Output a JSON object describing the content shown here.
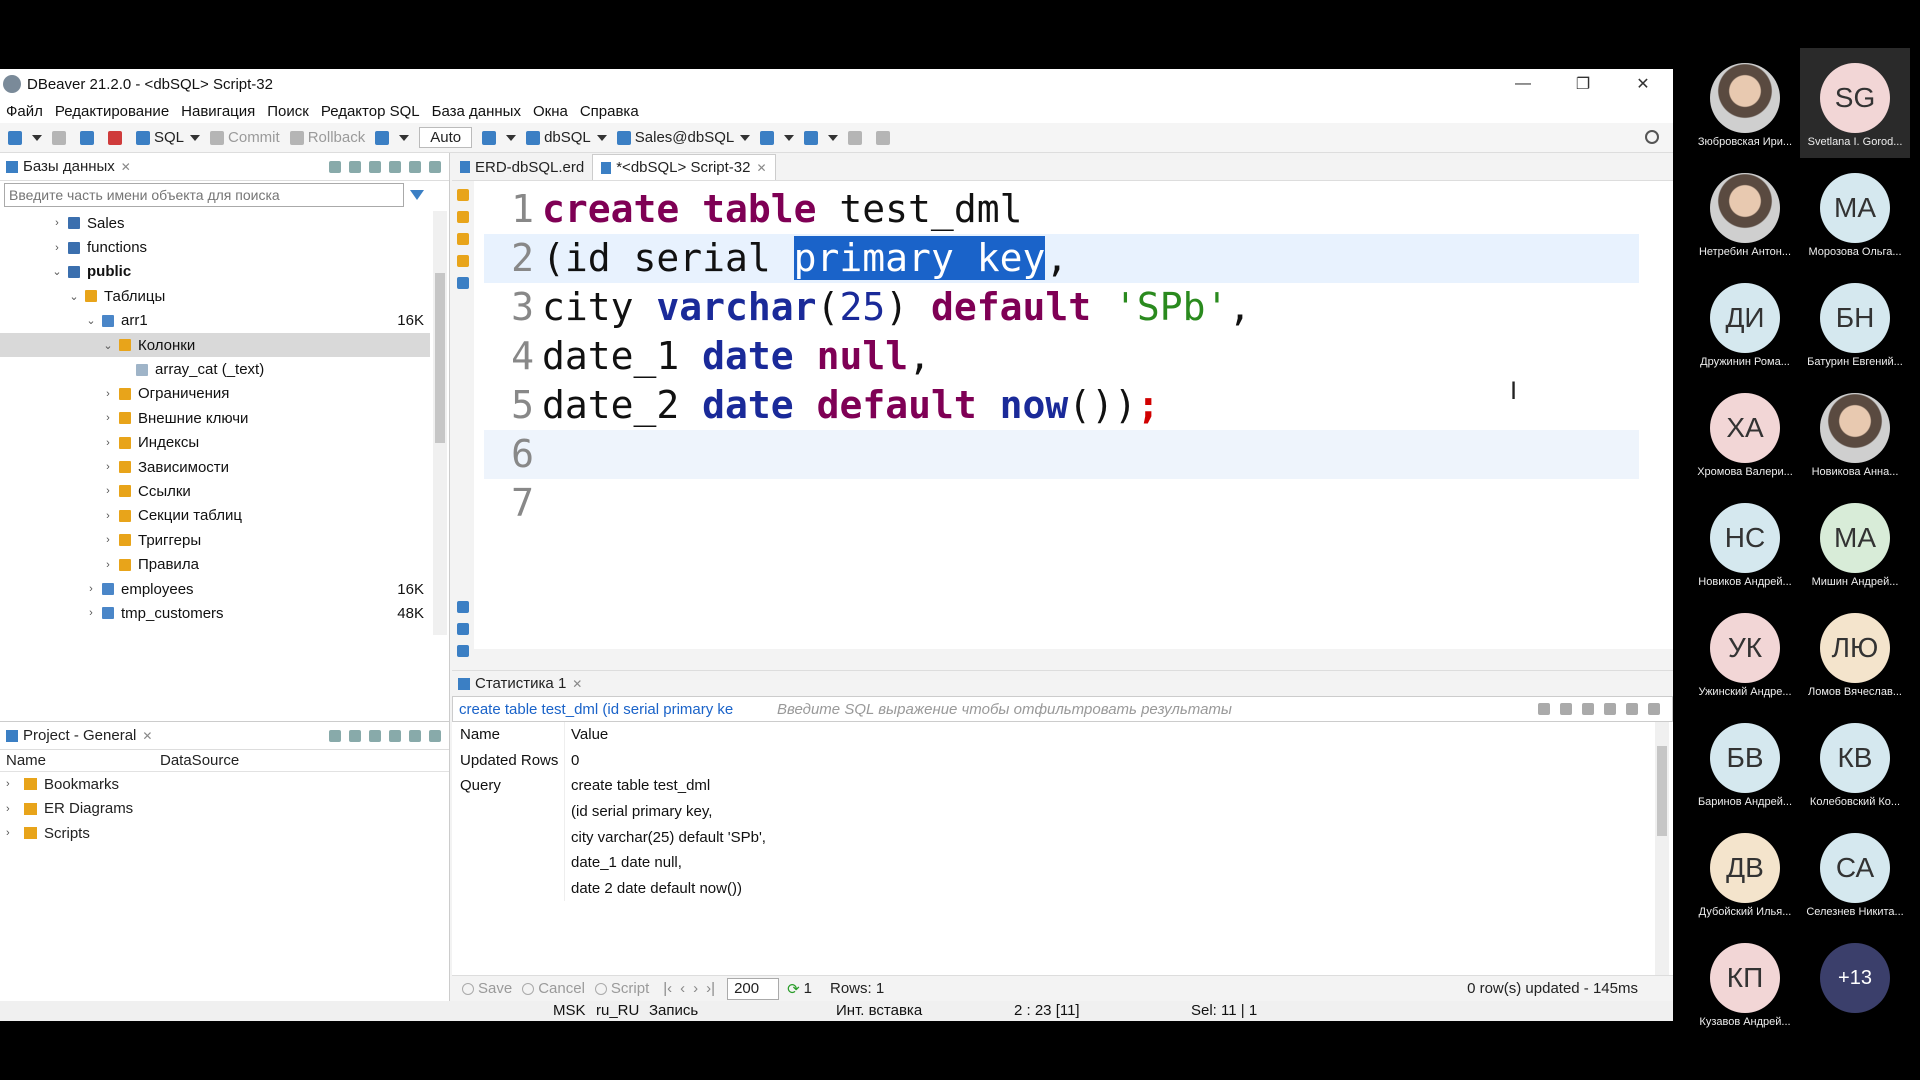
{
  "window": {
    "title": "DBeaver 21.2.0 - <dbSQL> Script-32",
    "minimize": "—",
    "restore": "❐",
    "close": "✕"
  },
  "menu": [
    "Файл",
    "Редактирование",
    "Навигация",
    "Поиск",
    "Редактор SQL",
    "База данных",
    "Окна",
    "Справка"
  ],
  "toolbar": {
    "sql": "SQL",
    "commit": "Commit",
    "rollback": "Rollback",
    "mode": "Auto",
    "datasource": "dbSQL",
    "schema": "Sales@dbSQL"
  },
  "db_panel": {
    "tab": "Базы данных",
    "filter_placeholder": "Введите часть имени объекта для поиска",
    "tree": [
      {
        "label": "Sales",
        "level": 1,
        "arrow": "›",
        "icon": "schema"
      },
      {
        "label": "functions",
        "level": 1,
        "arrow": "›",
        "icon": "schema"
      },
      {
        "label": "public",
        "level": 1,
        "arrow": "⌄",
        "icon": "schema",
        "bold": true
      },
      {
        "label": "Таблицы",
        "level": 2,
        "arrow": "⌄",
        "icon": "folder-table"
      },
      {
        "label": "arr1",
        "level": 3,
        "arrow": "⌄",
        "icon": "table",
        "size": "16K"
      },
      {
        "label": "Колонки",
        "level": 4,
        "arrow": "⌄",
        "icon": "folder",
        "selected": true
      },
      {
        "label": "array_cat (_text)",
        "level": 5,
        "arrow": "",
        "icon": "grid"
      },
      {
        "label": "Ограничения",
        "level": 4,
        "arrow": "›",
        "icon": "folder"
      },
      {
        "label": "Внешние ключи",
        "level": 4,
        "arrow": "›",
        "icon": "folder"
      },
      {
        "label": "Индексы",
        "level": 4,
        "arrow": "›",
        "icon": "folder"
      },
      {
        "label": "Зависимости",
        "level": 4,
        "arrow": "›",
        "icon": "folder"
      },
      {
        "label": "Ссылки",
        "level": 4,
        "arrow": "›",
        "icon": "folder"
      },
      {
        "label": "Секции таблиц",
        "level": 4,
        "arrow": "›",
        "icon": "folder-table"
      },
      {
        "label": "Триггеры",
        "level": 4,
        "arrow": "›",
        "icon": "folder"
      },
      {
        "label": "Правила",
        "level": 4,
        "arrow": "›",
        "icon": "folder"
      },
      {
        "label": "employees",
        "level": 3,
        "arrow": "›",
        "icon": "table",
        "size": "16K"
      },
      {
        "label": "tmp_customers",
        "level": 3,
        "arrow": "›",
        "icon": "table",
        "size": "48K"
      }
    ]
  },
  "project_panel": {
    "tab": "Project - General",
    "col_name": "Name",
    "col_datasource": "DataSource",
    "items": [
      "Bookmarks",
      "ER Diagrams",
      "Scripts"
    ]
  },
  "editor": {
    "tabs": [
      {
        "label": "ERD-dbSQL.erd",
        "active": false
      },
      {
        "label": "*<dbSQL> Script-32",
        "active": true
      }
    ],
    "line_numbers": [
      "1",
      "2",
      "3",
      "4",
      "5",
      "6",
      "7"
    ],
    "code": {
      "l1_kw": "create table",
      "l1_rest": " test_dml",
      "l2_pre": "(id serial ",
      "l2_sel": "primary key",
      "l2_post": ",",
      "l3_a": "city ",
      "l3_type": "varchar",
      "l3_p1": "(",
      "l3_num": "25",
      "l3_p2": ") ",
      "l3_kw": "default",
      "l3_sp": " ",
      "l3_str": "'SPb'",
      "l3_end": ",",
      "l4_a": "date_1 ",
      "l4_type": "date",
      "l4_sp": " ",
      "l4_kw": "null",
      "l4_end": ",",
      "l5_a": "date_2 ",
      "l5_type": "date",
      "l5_sp": " ",
      "l5_kw": "default",
      "l5_sp2": " ",
      "l5_fn": "now",
      "l5_end": "())",
      "l5_semi": ";"
    },
    "text_cursor": "I"
  },
  "results": {
    "tab": "Статистика 1",
    "query_preview": "create table test_dml (id serial primary ke",
    "filter_placeholder": "Введите SQL выражение чтобы отфильтровать результаты",
    "header": {
      "name": "Name",
      "value": "Value"
    },
    "rows": [
      {
        "name": "Updated Rows",
        "value": "0"
      },
      {
        "name": "Query",
        "value": "create table test_dml"
      },
      {
        "name": "",
        "value": "(id serial primary key,"
      },
      {
        "name": "",
        "value": "city varchar(25) default 'SPb',"
      },
      {
        "name": "",
        "value": "date_1 date null,"
      },
      {
        "name": "",
        "value": "date 2 date default now())"
      }
    ],
    "footer": {
      "save": "Save",
      "cancel": "Cancel",
      "script": "Script",
      "fetch_size": "200",
      "refresh_count": "1",
      "rows": "Rows: 1",
      "updated": "0 row(s) updated - 145ms"
    }
  },
  "statusbar": {
    "tz": "MSK",
    "locale": "ru_RU",
    "mode": "Запись",
    "insert": "Инт. вставка",
    "position": "2 : 23 [11]",
    "selection": "Sel: 11 | 1"
  },
  "participants": [
    {
      "initials": "",
      "name": "Зюбровская Ири...",
      "photo": true,
      "color": "#d9d9d9"
    },
    {
      "initials": "SG",
      "name": "Svetlana I. Gorod...",
      "color": "#f2d6d6",
      "active": true
    },
    {
      "initials": "",
      "name": "Нетребин Антон...",
      "photo": true,
      "color": "#c98a6a"
    },
    {
      "initials": "МА",
      "name": "Морозова Ольга...",
      "color": "#d5e8ef"
    },
    {
      "initials": "ДИ",
      "name": "Дружинин Рома...",
      "color": "#d5e8ef"
    },
    {
      "initials": "БН",
      "name": "Батурин Евгений...",
      "color": "#d5e8ef"
    },
    {
      "initials": "ХА",
      "name": "Хромова Валери...",
      "color": "#f2d6d6"
    },
    {
      "initials": "",
      "name": "Новикова Анна...",
      "photo": true,
      "color": "#bbbbbb"
    },
    {
      "initials": "НС",
      "name": "Новиков Андрей...",
      "color": "#d5e8ef"
    },
    {
      "initials": "МА",
      "name": "Мишин Андрей...",
      "color": "#d8ecd8"
    },
    {
      "initials": "УК",
      "name": "Ужинский Андре...",
      "color": "#f2d6d6"
    },
    {
      "initials": "ЛЮ",
      "name": "Ломов Вячеслав...",
      "color": "#f4e4cc"
    },
    {
      "initials": "БВ",
      "name": "Баринов Андрей...",
      "color": "#d5e8ef"
    },
    {
      "initials": "КВ",
      "name": "Колебовский Ко...",
      "color": "#d5e8ef"
    },
    {
      "initials": "ДВ",
      "name": "Дубойский Илья...",
      "color": "#f4e4cc"
    },
    {
      "initials": "СА",
      "name": "Селезнев Никита...",
      "color": "#d5e8ef"
    },
    {
      "initials": "КП",
      "name": "Кузавов Андрей...",
      "color": "#f2d6d6"
    },
    {
      "initials": "+13",
      "name": "",
      "color": "#3b3f6b"
    }
  ]
}
